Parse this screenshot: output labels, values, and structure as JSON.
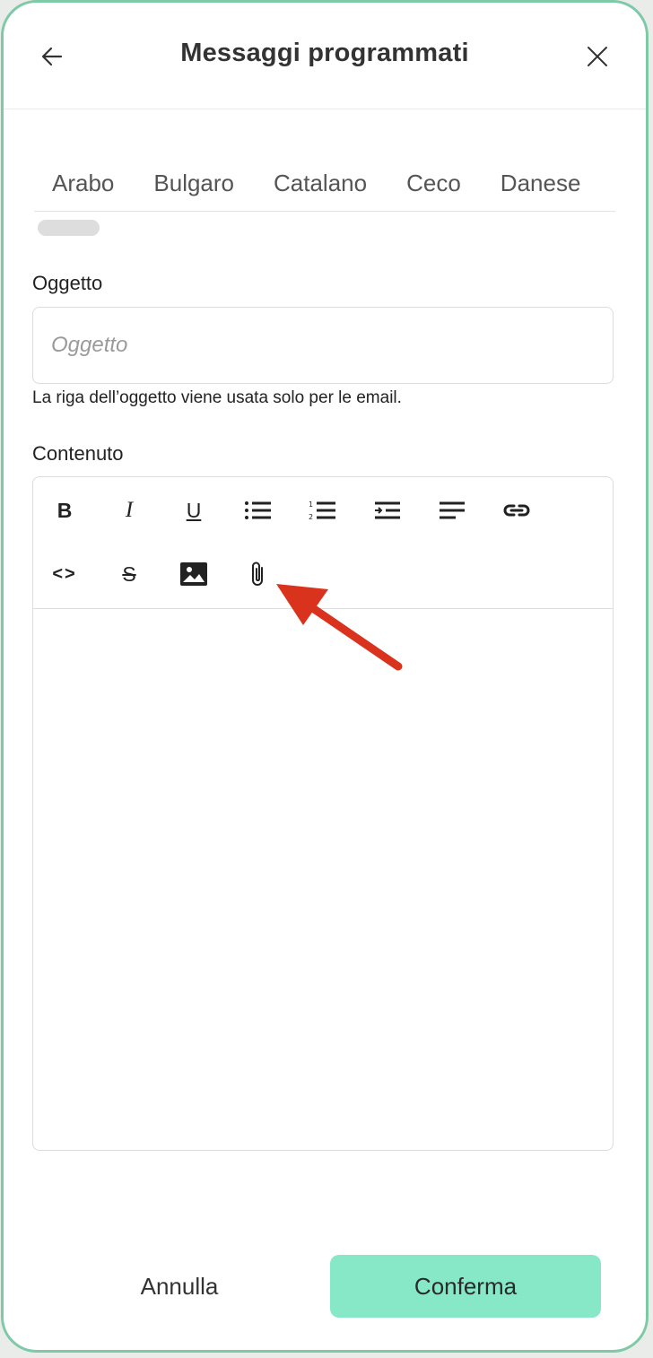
{
  "header": {
    "title": "Messaggi programmati"
  },
  "tabs": [
    "Arabo",
    "Bulgaro",
    "Catalano",
    "Ceco",
    "Danese"
  ],
  "subject": {
    "label": "Oggetto",
    "placeholder": "Oggetto",
    "value": "",
    "hint": "La riga dell’oggetto viene usata solo per le email."
  },
  "content": {
    "label": "Contenuto",
    "toolbar": [
      {
        "name": "bold",
        "glyph": "B"
      },
      {
        "name": "italic",
        "glyph": "I"
      },
      {
        "name": "underline",
        "glyph": "U"
      },
      {
        "name": "bullet-list",
        "icon": "bullet-list-icon"
      },
      {
        "name": "numbered-list",
        "icon": "numbered-list-icon"
      },
      {
        "name": "indent",
        "icon": "indent-icon"
      },
      {
        "name": "align-left",
        "icon": "align-left-icon"
      },
      {
        "name": "link",
        "icon": "link-icon"
      },
      {
        "name": "code",
        "glyph": "<>"
      },
      {
        "name": "strikethrough",
        "glyph": "S"
      },
      {
        "name": "image",
        "icon": "image-icon"
      },
      {
        "name": "attachment",
        "icon": "paperclip-icon"
      }
    ]
  },
  "footer": {
    "cancel_label": "Annulla",
    "confirm_label": "Conferma"
  },
  "colors": {
    "frame_border": "#7ec9a6",
    "confirm_bg": "#86e8c6",
    "annotation_arrow": "#d9331e"
  }
}
